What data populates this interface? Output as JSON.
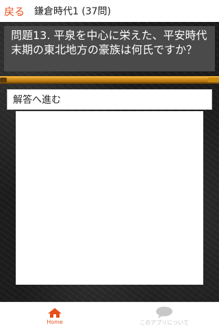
{
  "header": {
    "back_label": "戻る",
    "title": "鎌倉時代1 (37問)"
  },
  "question": {
    "text": "問題13. 平泉を中心に栄えた、平安時代末期の東北地方の豪族は何氏ですか？"
  },
  "progress": {
    "fraction": 0.95
  },
  "reveal": {
    "label": "解答へ進む"
  },
  "nav": {
    "items": [
      {
        "label": "Home",
        "icon": "home-icon",
        "active": true,
        "color": "#e8501a"
      },
      {
        "label": "このアプリについて",
        "icon": "chat-bubble-icon",
        "active": false,
        "color": "#c8c8c8"
      }
    ]
  },
  "colors": {
    "accent": "#e8501a",
    "progress": "#d9941e",
    "question_bg": "#4a4a4a"
  }
}
